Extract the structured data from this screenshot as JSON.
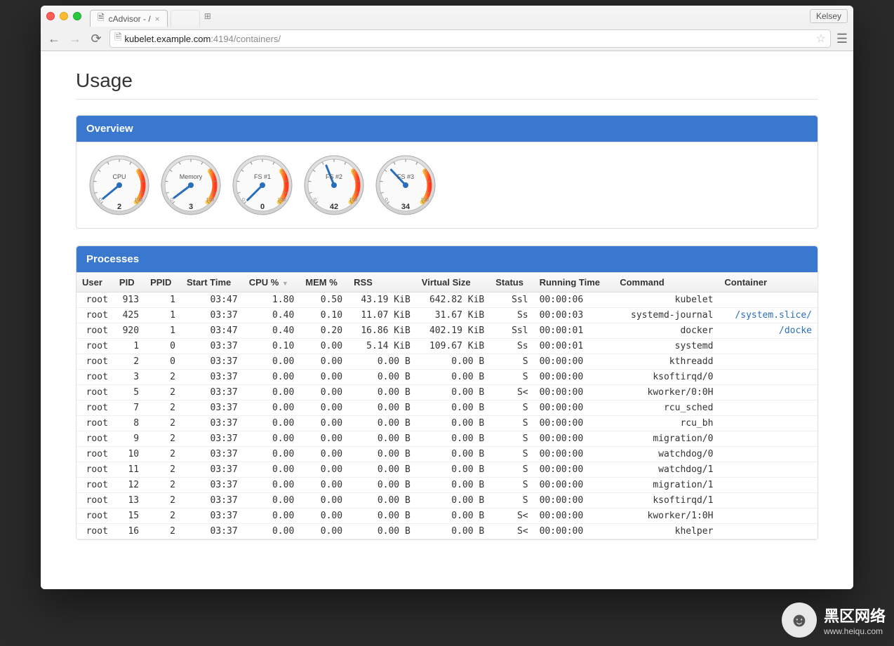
{
  "browser": {
    "tab_title": "cAdvisor - /",
    "profile": "Kelsey",
    "url_host": "kubelet.example.com",
    "url_port": ":4194",
    "url_path": "/containers/"
  },
  "page": {
    "title": "Usage"
  },
  "overview": {
    "heading": "Overview",
    "gauges": [
      {
        "label": "CPU",
        "value": "2",
        "min": "0",
        "max": "100",
        "pct": 0.02
      },
      {
        "label": "Memory",
        "value": "3",
        "min": "0",
        "max": "100",
        "pct": 0.03
      },
      {
        "label": "FS #1",
        "value": "0",
        "min": "0",
        "max": "100",
        "pct": 0.0
      },
      {
        "label": "FS #2",
        "value": "42",
        "min": "0",
        "max": "100",
        "pct": 0.42
      },
      {
        "label": "FS #3",
        "value": "34",
        "min": "0",
        "max": "100",
        "pct": 0.34
      }
    ]
  },
  "processes": {
    "heading": "Processes",
    "columns": [
      "User",
      "PID",
      "PPID",
      "Start Time",
      "CPU %",
      "MEM %",
      "RSS",
      "Virtual Size",
      "Status",
      "Running Time",
      "Command",
      "Container"
    ],
    "rows": [
      {
        "user": "root",
        "pid": "913",
        "ppid": "1",
        "start": "03:47",
        "cpu": "1.80",
        "mem": "0.50",
        "rss": "43.19 KiB",
        "vsz": "642.82 KiB",
        "status": "Ssl",
        "rtime": "00:00:06",
        "cmd": "kubelet",
        "container": ""
      },
      {
        "user": "root",
        "pid": "425",
        "ppid": "1",
        "start": "03:37",
        "cpu": "0.40",
        "mem": "0.10",
        "rss": "11.07 KiB",
        "vsz": "31.67 KiB",
        "status": "Ss",
        "rtime": "00:00:03",
        "cmd": "systemd-journal",
        "container": "/system.slice/"
      },
      {
        "user": "root",
        "pid": "920",
        "ppid": "1",
        "start": "03:47",
        "cpu": "0.40",
        "mem": "0.20",
        "rss": "16.86 KiB",
        "vsz": "402.19 KiB",
        "status": "Ssl",
        "rtime": "00:00:01",
        "cmd": "docker",
        "container": "/docke"
      },
      {
        "user": "root",
        "pid": "1",
        "ppid": "0",
        "start": "03:37",
        "cpu": "0.10",
        "mem": "0.00",
        "rss": "5.14 KiB",
        "vsz": "109.67 KiB",
        "status": "Ss",
        "rtime": "00:00:01",
        "cmd": "systemd",
        "container": ""
      },
      {
        "user": "root",
        "pid": "2",
        "ppid": "0",
        "start": "03:37",
        "cpu": "0.00",
        "mem": "0.00",
        "rss": "0.00 B",
        "vsz": "0.00 B",
        "status": "S",
        "rtime": "00:00:00",
        "cmd": "kthreadd",
        "container": ""
      },
      {
        "user": "root",
        "pid": "3",
        "ppid": "2",
        "start": "03:37",
        "cpu": "0.00",
        "mem": "0.00",
        "rss": "0.00 B",
        "vsz": "0.00 B",
        "status": "S",
        "rtime": "00:00:00",
        "cmd": "ksoftirqd/0",
        "container": ""
      },
      {
        "user": "root",
        "pid": "5",
        "ppid": "2",
        "start": "03:37",
        "cpu": "0.00",
        "mem": "0.00",
        "rss": "0.00 B",
        "vsz": "0.00 B",
        "status": "S<",
        "rtime": "00:00:00",
        "cmd": "kworker/0:0H",
        "container": ""
      },
      {
        "user": "root",
        "pid": "7",
        "ppid": "2",
        "start": "03:37",
        "cpu": "0.00",
        "mem": "0.00",
        "rss": "0.00 B",
        "vsz": "0.00 B",
        "status": "S",
        "rtime": "00:00:00",
        "cmd": "rcu_sched",
        "container": ""
      },
      {
        "user": "root",
        "pid": "8",
        "ppid": "2",
        "start": "03:37",
        "cpu": "0.00",
        "mem": "0.00",
        "rss": "0.00 B",
        "vsz": "0.00 B",
        "status": "S",
        "rtime": "00:00:00",
        "cmd": "rcu_bh",
        "container": ""
      },
      {
        "user": "root",
        "pid": "9",
        "ppid": "2",
        "start": "03:37",
        "cpu": "0.00",
        "mem": "0.00",
        "rss": "0.00 B",
        "vsz": "0.00 B",
        "status": "S",
        "rtime": "00:00:00",
        "cmd": "migration/0",
        "container": ""
      },
      {
        "user": "root",
        "pid": "10",
        "ppid": "2",
        "start": "03:37",
        "cpu": "0.00",
        "mem": "0.00",
        "rss": "0.00 B",
        "vsz": "0.00 B",
        "status": "S",
        "rtime": "00:00:00",
        "cmd": "watchdog/0",
        "container": ""
      },
      {
        "user": "root",
        "pid": "11",
        "ppid": "2",
        "start": "03:37",
        "cpu": "0.00",
        "mem": "0.00",
        "rss": "0.00 B",
        "vsz": "0.00 B",
        "status": "S",
        "rtime": "00:00:00",
        "cmd": "watchdog/1",
        "container": ""
      },
      {
        "user": "root",
        "pid": "12",
        "ppid": "2",
        "start": "03:37",
        "cpu": "0.00",
        "mem": "0.00",
        "rss": "0.00 B",
        "vsz": "0.00 B",
        "status": "S",
        "rtime": "00:00:00",
        "cmd": "migration/1",
        "container": ""
      },
      {
        "user": "root",
        "pid": "13",
        "ppid": "2",
        "start": "03:37",
        "cpu": "0.00",
        "mem": "0.00",
        "rss": "0.00 B",
        "vsz": "0.00 B",
        "status": "S",
        "rtime": "00:00:00",
        "cmd": "ksoftirqd/1",
        "container": ""
      },
      {
        "user": "root",
        "pid": "15",
        "ppid": "2",
        "start": "03:37",
        "cpu": "0.00",
        "mem": "0.00",
        "rss": "0.00 B",
        "vsz": "0.00 B",
        "status": "S<",
        "rtime": "00:00:00",
        "cmd": "kworker/1:0H",
        "container": ""
      },
      {
        "user": "root",
        "pid": "16",
        "ppid": "2",
        "start": "03:37",
        "cpu": "0.00",
        "mem": "0.00",
        "rss": "0.00 B",
        "vsz": "0.00 B",
        "status": "S<",
        "rtime": "00:00:00",
        "cmd": "khelper",
        "container": ""
      }
    ]
  },
  "watermark": {
    "main": "黑区网络",
    "sub": "www.heiqu.com"
  }
}
